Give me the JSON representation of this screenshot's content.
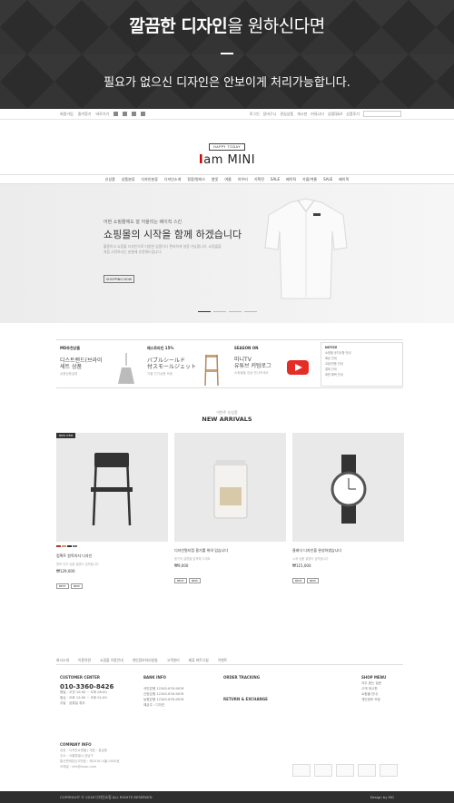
{
  "banner": {
    "headline_bold": "깔끔한 디자인",
    "headline_rest": "을 원하신다면",
    "sub": "필요가 없으신 디자인은 안보이게 처리가능합니다."
  },
  "topbar": {
    "left": [
      "회원가입",
      "즐겨찾기",
      "바로가기"
    ],
    "right": [
      "로그인",
      "장바구니",
      "관심상품",
      "게시판",
      "커뮤니티",
      "상품Q&A",
      "상품후기"
    ]
  },
  "logo": {
    "small": "HAPPY TODAY",
    "main_i": "I",
    "main_rest": "am MINI"
  },
  "nav": [
    "신상품",
    "상품분류",
    "디자인분류",
    "디자인소개",
    "정장/원피스",
    "봄옷",
    "여름",
    "아우터",
    "기획전",
    "SALE",
    "베이직",
    "가을/겨울",
    "SALE",
    "베이직"
  ],
  "hero": {
    "sub": "어떤 쇼핑몰에도 잘 어울리는 베이직 스킨",
    "title": "쇼핑몰의 시작을 함께 하겠습니다",
    "desc": "활용하고 쇼핑몰 디자인으로 다양한 상품이나 편리하게 설정 가능합니다. 쇼핑몰을 처음 시작하시는 분들께 추천해드립니다.",
    "button": "SHOPPING NOW"
  },
  "feat": [
    {
      "t": "MD추천상품",
      "a": "디스트랜드(브라이\n세트 상품",
      "s": "상품상품설명"
    },
    {
      "t": "베스트라인 15%",
      "a": "バブルシールド\n付スモールジェット",
      "s": "가을 인기상품 모음"
    },
    {
      "t": "SEASON ON",
      "a": "미니TV\n유튜브 커텀로그",
      "s": "쇼핑몰을 영상 만나보세요"
    }
  ],
  "notice": {
    "title": "NOTICE",
    "items": [
      "쇼핑몰 공지사항 안내",
      "배송 안내",
      "교환/반품 안내",
      "결제 안내",
      "회원 혜택 안내"
    ]
  },
  "arrivals": {
    "sub": "이번주 신상품",
    "title": "NEW ARRIVALS"
  },
  "products": [
    {
      "badge": "NEW ITEM",
      "name": "컴팩트 원목의자 디자인",
      "desc": "원목 의자 상품 설명이 입력됩니다",
      "price": "₩129,000",
      "tags": [
        "BEST",
        "NEW"
      ]
    },
    {
      "name": "디자인멀티컵 용기를 위의 입습니다",
      "desc": "용기의 설명을 입력해 주세요",
      "price": "₩9,000",
      "tags": [
        "BEST",
        "NEW"
      ]
    },
    {
      "name": "클래식 디자인을 완성하였습니다",
      "desc": "시계 상품 설명이 입력됩니다",
      "price": "₩115,000",
      "tags": [
        "BEST",
        "NEW"
      ]
    }
  ],
  "footer": {
    "links": [
      "회사소개",
      "이용약관",
      "쇼핑몰 이용안내",
      "개인정보처리방침",
      "고객센터",
      "제휴 파트너쉽",
      "이벤트"
    ],
    "cs_title": "CUSTOMER CENTER",
    "phone": "010-3360-8426",
    "cs_hours": [
      "평일 : 오전 10:00 ~ 오후 06:00",
      "점심 : 오후 12:00 ~ 오후 01:00",
      "주말 · 공휴일 휴무"
    ],
    "bank_title": "BANK INFO",
    "bank": [
      "국민은행 12345-678-9876",
      "신한은행 12345-678-9876",
      "농협은행 12345-678-9876",
      "예금주 : 디자인"
    ],
    "order_title": "ORDER TRACKING",
    "return_title": "RETURN & EXCHANGE",
    "shop_title": "SHOP MENU",
    "shop_menu": [
      "자주 묻는 질문",
      "고객 게시판",
      "쇼핑몰 안내",
      "개인정보 보호"
    ],
    "company_title": "COMPANY INFO",
    "company": [
      "상호 : 디자인쇼핑몰 | 대표 : 홍길동",
      "주소 : 서울특별시 강남구",
      "통신판매업신고번호 : 제2018-서울-0000호",
      "이메일 : info@shop.com"
    ],
    "copyright": "COPYRIGHT © 2018 디자인쇼핑 ALL RIGHTS RESERVED",
    "design": "Design by MG"
  }
}
